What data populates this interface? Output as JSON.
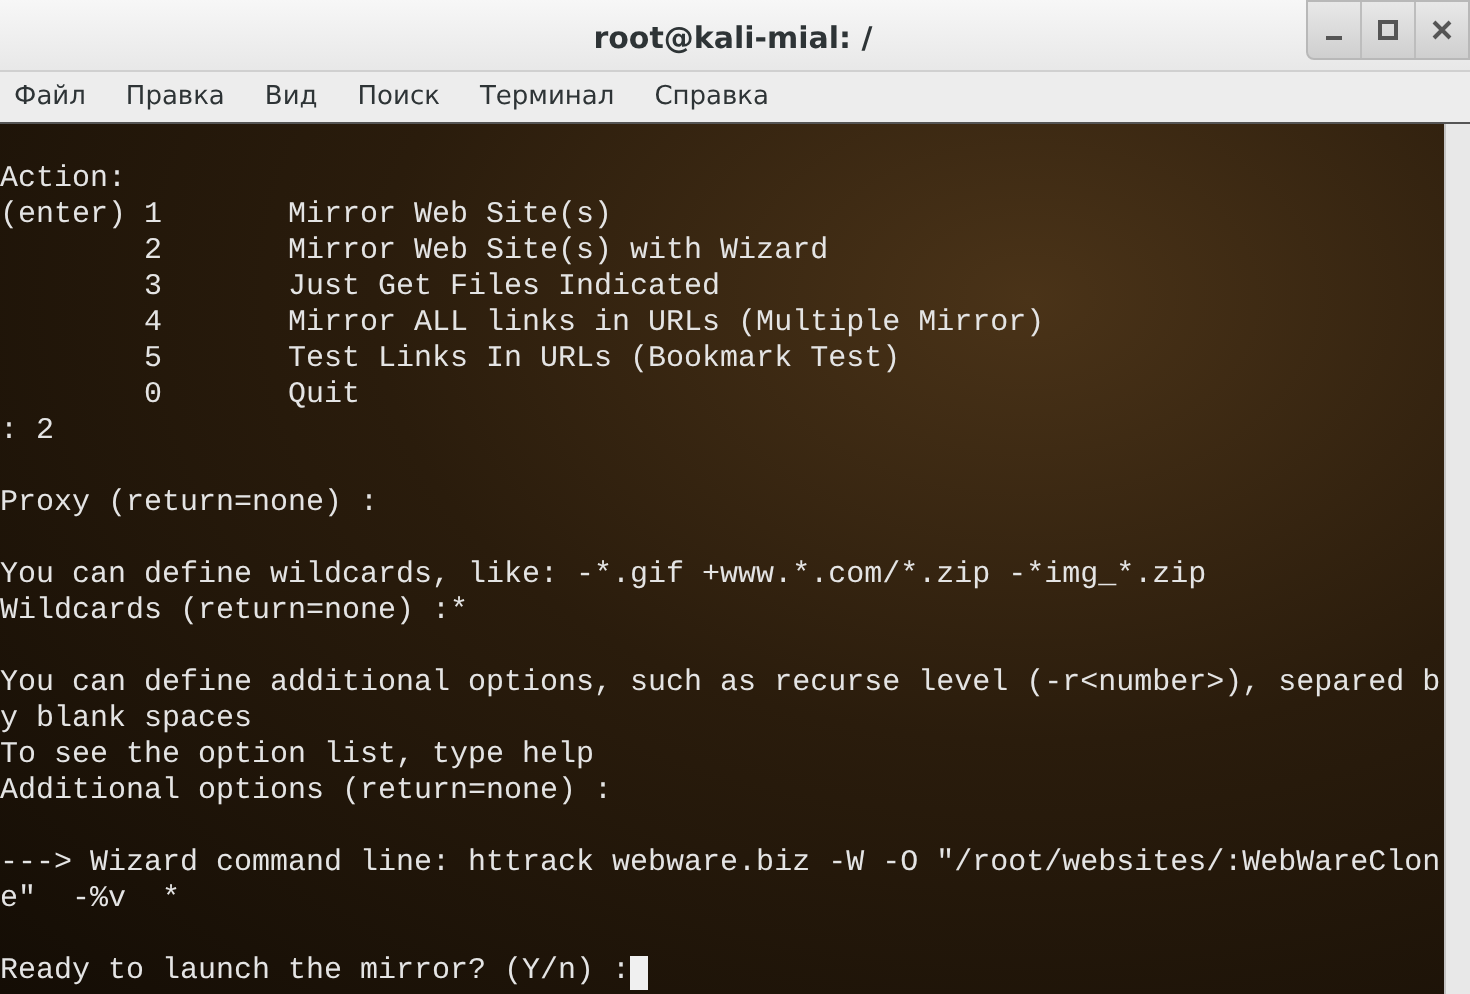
{
  "window": {
    "title": "root@kali-mial: /"
  },
  "menu": [
    "Файл",
    "Правка",
    "Вид",
    "Поиск",
    "Терминал",
    "Справка"
  ],
  "terminal": {
    "cursor": true,
    "blocks": [
      [
        "Action:",
        "(enter) 1       Mirror Web Site(s)",
        "        2       Mirror Web Site(s) with Wizard",
        "        3       Just Get Files Indicated",
        "        4       Mirror ALL links in URLs (Multiple Mirror)",
        "        5       Test Links In URLs (Bookmark Test)",
        "        0       Quit",
        ": 2"
      ],
      [
        "Proxy (return=none) :"
      ],
      [
        "You can define wildcards, like: -*.gif +www.*.com/*.zip -*img_*.zip",
        "Wildcards (return=none) :*"
      ],
      [
        "You can define additional options, such as recurse level (-r<number>), separed b",
        "y blank spaces",
        "To see the option list, type help",
        "Additional options (return=none) :"
      ],
      [
        "---> Wizard command line: httrack webware.biz -W -O \"/root/websites/:WebWareClon",
        "e\"  -%v  *"
      ],
      [
        "Ready to launch the mirror? (Y/n) :"
      ]
    ]
  }
}
